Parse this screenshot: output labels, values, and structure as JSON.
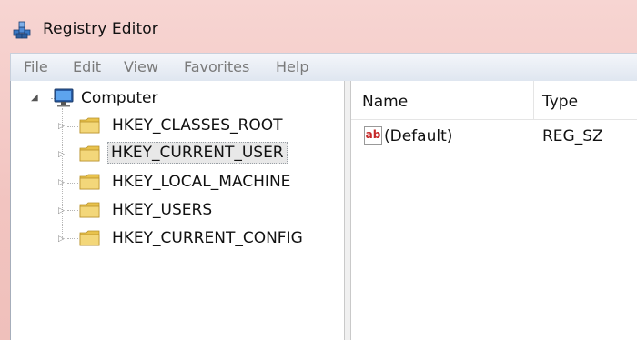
{
  "window": {
    "title": "Registry Editor"
  },
  "menu": [
    "File",
    "Edit",
    "View",
    "Favorites",
    "Help"
  ],
  "tree": {
    "root": "Computer",
    "keys": [
      "HKEY_CLASSES_ROOT",
      "HKEY_CURRENT_USER",
      "HKEY_LOCAL_MACHINE",
      "HKEY_USERS",
      "HKEY_CURRENT_CONFIG"
    ],
    "selected_key": "HKEY_CURRENT_USER"
  },
  "list": {
    "columns": [
      "Name",
      "Type"
    ],
    "rows": [
      {
        "icon": "string-value-icon",
        "icon_text": "ab",
        "name": "(Default)",
        "type": "REG_SZ"
      }
    ]
  },
  "icons": {
    "app": "registry-editor-icon",
    "computer": "computer-icon",
    "folder": "folder-icon"
  },
  "colors": {
    "title_bar": "#f4c9c9",
    "menu_text": "#7a7a7a",
    "selection": "#e8e8e8",
    "folder": "#e8c24d",
    "string_icon_red": "#c62828"
  }
}
